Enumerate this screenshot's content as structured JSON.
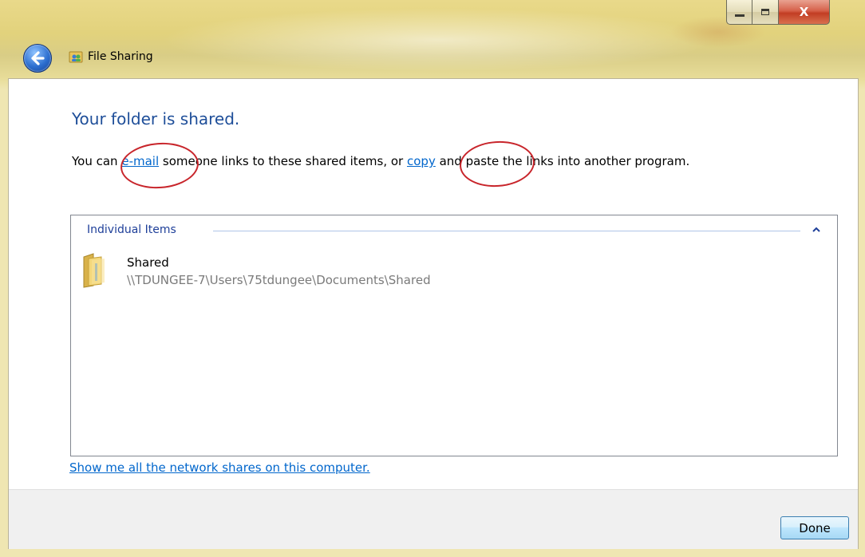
{
  "window": {
    "title": "File Sharing",
    "caption_buttons": {
      "minimize": "minimize",
      "maximize": "maximize",
      "close": "X"
    }
  },
  "content": {
    "heading": "Your folder is shared.",
    "desc_before_email": "You can ",
    "email_link": "e-mail",
    "desc_middle": " someone links to these shared items, or ",
    "copy_link": "copy",
    "desc_after": " and paste the links into another program."
  },
  "items_group": {
    "header": "Individual Items",
    "items": [
      {
        "name": "Shared",
        "path": "\\\\TDUNGEE-7\\Users\\75tdungee\\Documents\\Shared"
      }
    ]
  },
  "footer": {
    "show_shares_link": "Show me all the network shares on this computer.",
    "done_label": "Done"
  },
  "icons": {
    "back": "back-arrow-icon",
    "title": "file-sharing-icon",
    "folder": "folder-icon",
    "collapse": "chevron-up-icon"
  },
  "colors": {
    "heading": "#1e4e99",
    "link": "#0066cc",
    "annotation": "#c8252b"
  }
}
